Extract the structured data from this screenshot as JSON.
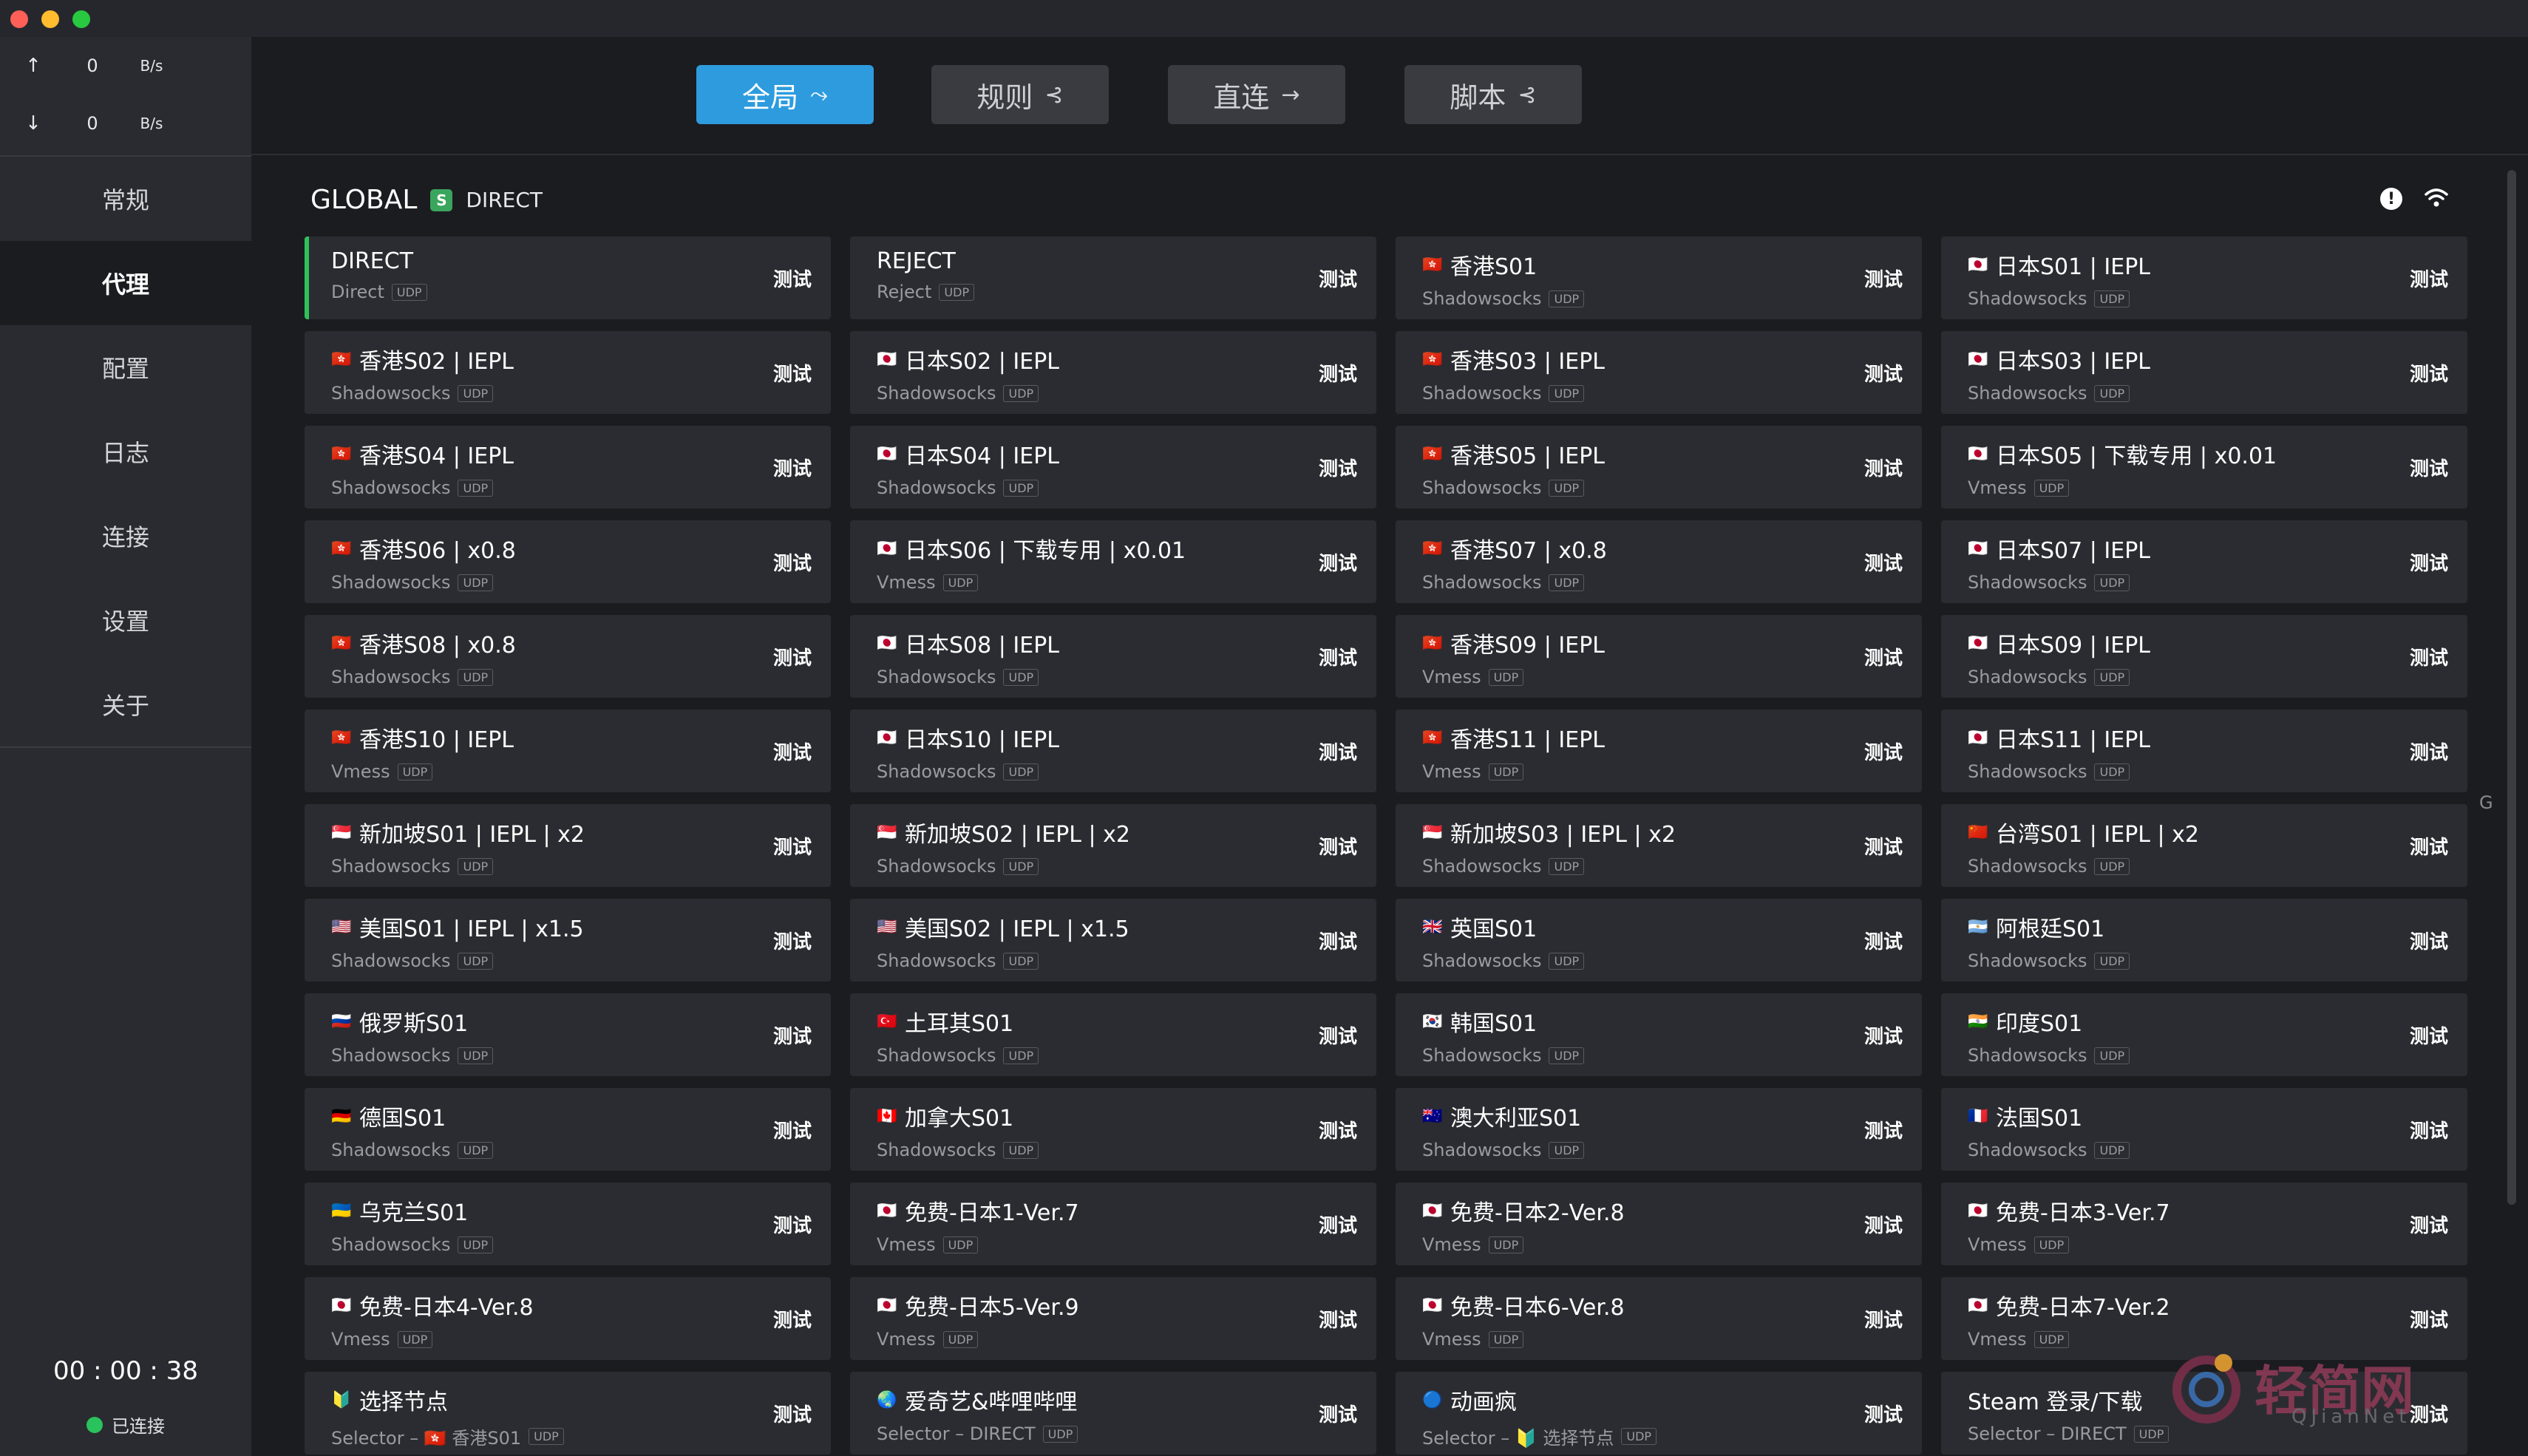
{
  "window": {
    "controls": [
      "close",
      "minimize",
      "zoom"
    ]
  },
  "sidebar": {
    "traffic": {
      "up": {
        "arrow": "↑",
        "value": "0",
        "unit": "B/s"
      },
      "down": {
        "arrow": "↓",
        "value": "0",
        "unit": "B/s"
      }
    },
    "nav": [
      "常规",
      "代理",
      "配置",
      "日志",
      "连接",
      "设置",
      "关于"
    ],
    "active_index": 1,
    "timer": "00 : 00 : 38",
    "status": "已连接"
  },
  "modes": [
    {
      "label": "全局",
      "icon": "⤳",
      "active": true
    },
    {
      "label": "规则",
      "icon": "⊰",
      "active": false
    },
    {
      "label": "直连",
      "icon": "→",
      "active": false
    },
    {
      "label": "脚本",
      "icon": "⊰",
      "active": false
    }
  ],
  "group": {
    "name": "GLOBAL",
    "badge": "S",
    "selected": "DIRECT"
  },
  "test_label": "测试",
  "udp_label": "UDP",
  "side_hint": "G",
  "watermark": {
    "text": "轻简网",
    "sub": "QJianNet"
  },
  "proxies": [
    {
      "name": "DIRECT",
      "flag": "",
      "type": "Direct",
      "selected": true
    },
    {
      "name": "REJECT",
      "flag": "",
      "type": "Reject"
    },
    {
      "name": "香港S01",
      "flag": "🇭🇰",
      "type": "Shadowsocks"
    },
    {
      "name": "日本S01 | IEPL",
      "flag": "🇯🇵",
      "type": "Shadowsocks"
    },
    {
      "name": "香港S02 | IEPL",
      "flag": "🇭🇰",
      "type": "Shadowsocks"
    },
    {
      "name": "日本S02 | IEPL",
      "flag": "🇯🇵",
      "type": "Shadowsocks"
    },
    {
      "name": "香港S03 | IEPL",
      "flag": "🇭🇰",
      "type": "Shadowsocks"
    },
    {
      "name": "日本S03 | IEPL",
      "flag": "🇯🇵",
      "type": "Shadowsocks"
    },
    {
      "name": "香港S04 | IEPL",
      "flag": "🇭🇰",
      "type": "Shadowsocks"
    },
    {
      "name": "日本S04 | IEPL",
      "flag": "🇯🇵",
      "type": "Shadowsocks"
    },
    {
      "name": "香港S05 | IEPL",
      "flag": "🇭🇰",
      "type": "Shadowsocks"
    },
    {
      "name": "日本S05 | 下载专用 | x0.01",
      "flag": "🇯🇵",
      "type": "Vmess"
    },
    {
      "name": "香港S06 | x0.8",
      "flag": "🇭🇰",
      "type": "Shadowsocks"
    },
    {
      "name": "日本S06 | 下载专用 | x0.01",
      "flag": "🇯🇵",
      "type": "Vmess"
    },
    {
      "name": "香港S07 | x0.8",
      "flag": "🇭🇰",
      "type": "Shadowsocks"
    },
    {
      "name": "日本S07 | IEPL",
      "flag": "🇯🇵",
      "type": "Shadowsocks"
    },
    {
      "name": "香港S08 | x0.8",
      "flag": "🇭🇰",
      "type": "Shadowsocks"
    },
    {
      "name": "日本S08 | IEPL",
      "flag": "🇯🇵",
      "type": "Shadowsocks"
    },
    {
      "name": "香港S09 | IEPL",
      "flag": "🇭🇰",
      "type": "Vmess"
    },
    {
      "name": "日本S09 | IEPL",
      "flag": "🇯🇵",
      "type": "Shadowsocks"
    },
    {
      "name": "香港S10 | IEPL",
      "flag": "🇭🇰",
      "type": "Vmess"
    },
    {
      "name": "日本S10 | IEPL",
      "flag": "🇯🇵",
      "type": "Shadowsocks"
    },
    {
      "name": "香港S11 | IEPL",
      "flag": "🇭🇰",
      "type": "Vmess"
    },
    {
      "name": "日本S11 | IEPL",
      "flag": "🇯🇵",
      "type": "Shadowsocks"
    },
    {
      "name": "新加坡S01 | IEPL | x2",
      "flag": "🇸🇬",
      "type": "Shadowsocks"
    },
    {
      "name": "新加坡S02 | IEPL | x2",
      "flag": "🇸🇬",
      "type": "Shadowsocks"
    },
    {
      "name": "新加坡S03 | IEPL | x2",
      "flag": "🇸🇬",
      "type": "Shadowsocks"
    },
    {
      "name": "台湾S01 | IEPL | x2",
      "flag": "🇨🇳",
      "type": "Shadowsocks"
    },
    {
      "name": "美国S01 | IEPL | x1.5",
      "flag": "🇺🇸",
      "type": "Shadowsocks"
    },
    {
      "name": "美国S02 | IEPL | x1.5",
      "flag": "🇺🇸",
      "type": "Shadowsocks"
    },
    {
      "name": "英国S01",
      "flag": "🇬🇧",
      "type": "Shadowsocks"
    },
    {
      "name": "阿根廷S01",
      "flag": "🇦🇷",
      "type": "Shadowsocks"
    },
    {
      "name": "俄罗斯S01",
      "flag": "🇷🇺",
      "type": "Shadowsocks"
    },
    {
      "name": "土耳其S01",
      "flag": "🇹🇷",
      "type": "Shadowsocks"
    },
    {
      "name": "韩国S01",
      "flag": "🇰🇷",
      "type": "Shadowsocks"
    },
    {
      "name": "印度S01",
      "flag": "🇮🇳",
      "type": "Shadowsocks"
    },
    {
      "name": "德国S01",
      "flag": "🇩🇪",
      "type": "Shadowsocks"
    },
    {
      "name": "加拿大S01",
      "flag": "🇨🇦",
      "type": "Shadowsocks"
    },
    {
      "name": "澳大利亚S01",
      "flag": "🇦🇺",
      "type": "Shadowsocks"
    },
    {
      "name": "法国S01",
      "flag": "🇫🇷",
      "type": "Shadowsocks"
    },
    {
      "name": "乌克兰S01",
      "flag": "🇺🇦",
      "type": "Shadowsocks"
    },
    {
      "name": "免费-日本1-Ver.7",
      "flag": "🇯🇵",
      "type": "Vmess"
    },
    {
      "name": "免费-日本2-Ver.8",
      "flag": "🇯🇵",
      "type": "Vmess"
    },
    {
      "name": "免费-日本3-Ver.7",
      "flag": "🇯🇵",
      "type": "Vmess"
    },
    {
      "name": "免费-日本4-Ver.8",
      "flag": "🇯🇵",
      "type": "Vmess"
    },
    {
      "name": "免费-日本5-Ver.9",
      "flag": "🇯🇵",
      "type": "Vmess"
    },
    {
      "name": "免费-日本6-Ver.8",
      "flag": "🇯🇵",
      "type": "Vmess"
    },
    {
      "name": "免费-日本7-Ver.2",
      "flag": "🇯🇵",
      "type": "Vmess"
    },
    {
      "name": "选择节点",
      "flag": "🔰",
      "type": "Selector – 🇭🇰 香港S01"
    },
    {
      "name": "爱奇艺&哔哩哔哩",
      "flag": "🌏",
      "type": "Selector – DIRECT"
    },
    {
      "name": "动画疯",
      "flag": "🔵",
      "type": "Selector – 🔰 选择节点"
    },
    {
      "name": "Steam 登录/下载",
      "flag": "",
      "type": "Selector – DIRECT"
    }
  ],
  "colors": {
    "background": "#1b1c20",
    "sidebar": "#2a2b30",
    "card": "#2b2c31",
    "accent": "#2e9bde",
    "selected_bar": "#2fc15a",
    "connected": "#29c25c"
  }
}
